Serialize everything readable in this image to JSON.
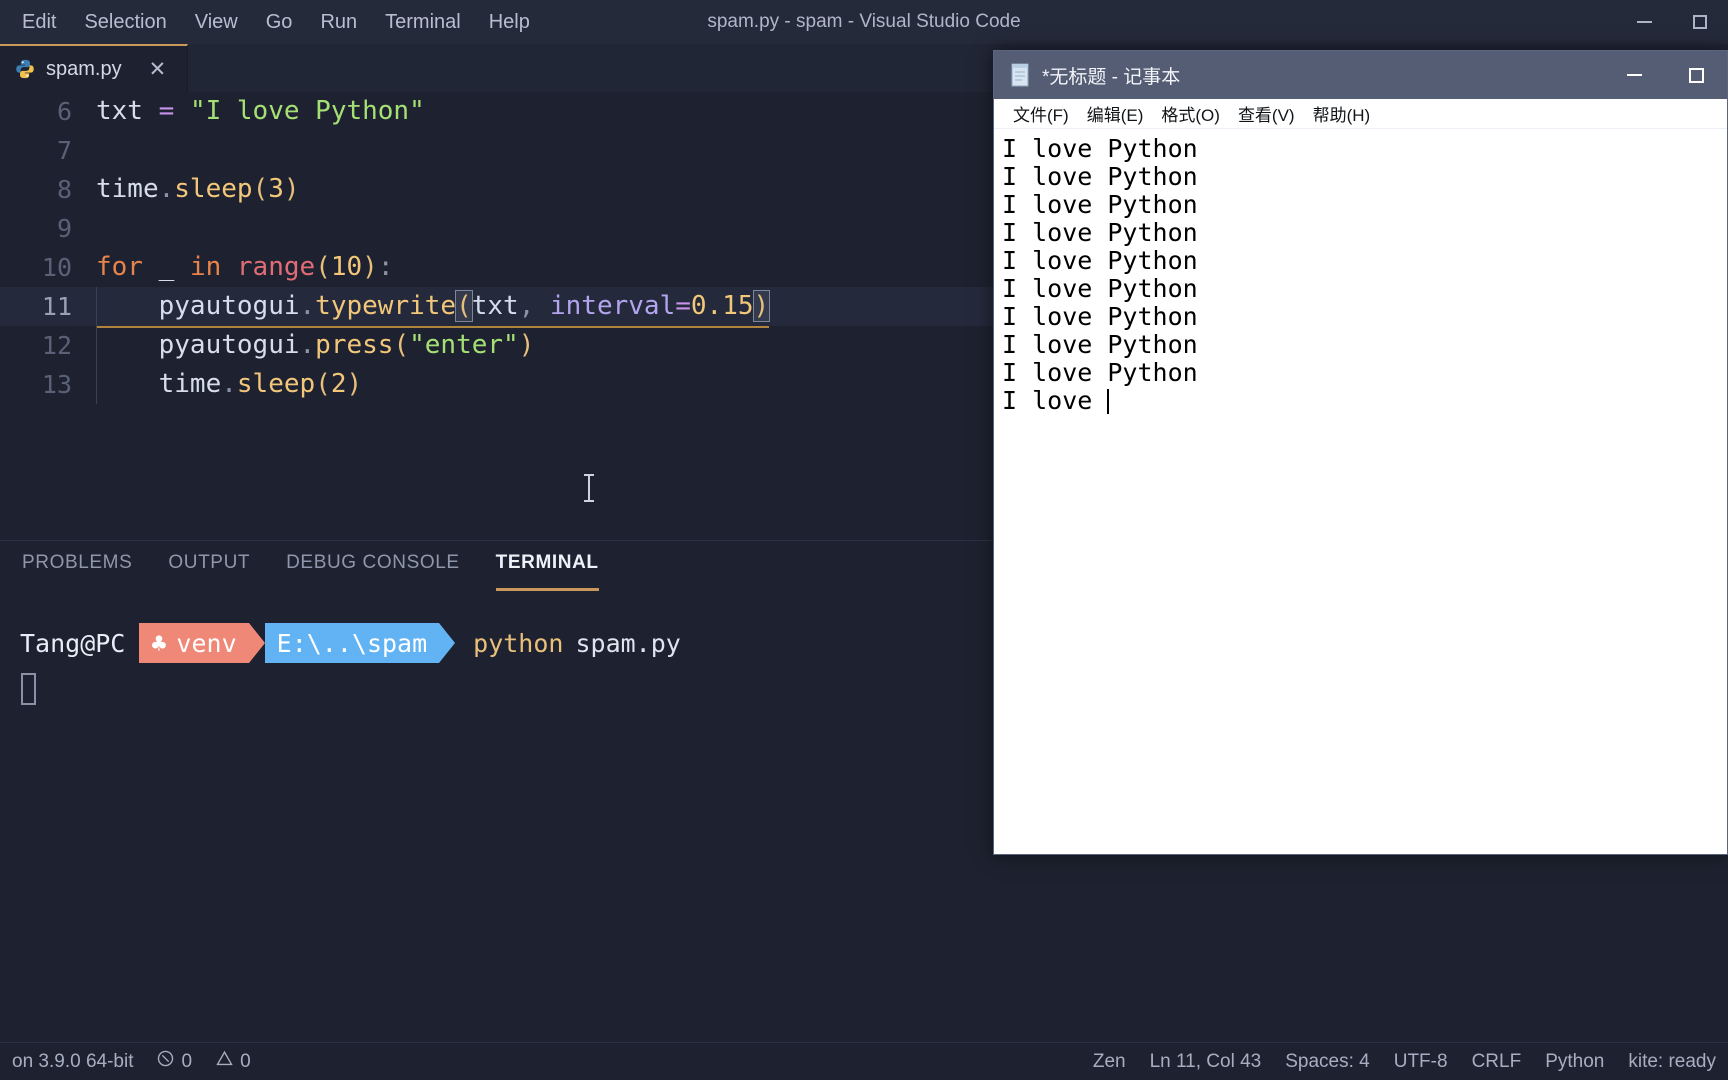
{
  "vscode": {
    "window_title": "spam.py - spam - Visual Studio Code",
    "menu": [
      {
        "label": "Edit"
      },
      {
        "label": "Selection"
      },
      {
        "label": "View"
      },
      {
        "label": "Go"
      },
      {
        "label": "Run"
      },
      {
        "label": "Terminal"
      },
      {
        "label": "Help"
      }
    ],
    "window_controls": {
      "minimize": "minimize-icon",
      "maximize": "maximize-icon"
    },
    "tab": {
      "label": "spam.py",
      "icon": "python-file-icon",
      "close": "✕",
      "accent_color": "#c9985a"
    },
    "editor": {
      "language": "Python",
      "lines": [
        {
          "number": "6",
          "active": false,
          "indent_guide": false,
          "tokens": [
            {
              "text": "txt",
              "cls": "t-var"
            },
            {
              "text": " ",
              "cls": "t-plain"
            },
            {
              "text": "=",
              "cls": "t-op"
            },
            {
              "text": " ",
              "cls": "t-plain"
            },
            {
              "text": "\"I love Python\"",
              "cls": "t-str"
            }
          ]
        },
        {
          "number": "7",
          "active": false,
          "indent_guide": false,
          "tokens": []
        },
        {
          "number": "8",
          "active": false,
          "indent_guide": false,
          "tokens": [
            {
              "text": "time",
              "cls": "t-var"
            },
            {
              "text": ".",
              "cls": "t-punct"
            },
            {
              "text": "sleep",
              "cls": "t-fn"
            },
            {
              "text": "(",
              "cls": "t-paren"
            },
            {
              "text": "3",
              "cls": "t-num"
            },
            {
              "text": ")",
              "cls": "t-paren"
            }
          ]
        },
        {
          "number": "9",
          "active": false,
          "indent_guide": false,
          "tokens": []
        },
        {
          "number": "10",
          "active": false,
          "indent_guide": false,
          "tokens": [
            {
              "text": "for",
              "cls": "t-kw"
            },
            {
              "text": " ",
              "cls": "t-plain"
            },
            {
              "text": "_",
              "cls": "t-var"
            },
            {
              "text": " ",
              "cls": "t-plain"
            },
            {
              "text": "in",
              "cls": "t-kw"
            },
            {
              "text": " ",
              "cls": "t-plain"
            },
            {
              "text": "range",
              "cls": "t-builtin"
            },
            {
              "text": "(",
              "cls": "t-paren"
            },
            {
              "text": "10",
              "cls": "t-num"
            },
            {
              "text": ")",
              "cls": "t-paren"
            },
            {
              "text": ":",
              "cls": "t-punct"
            }
          ]
        },
        {
          "number": "11",
          "active": true,
          "indent_guide": true,
          "tokens": [
            {
              "text": "    ",
              "cls": "t-plain"
            },
            {
              "text": "pyautogui",
              "cls": "t-var"
            },
            {
              "text": ".",
              "cls": "t-punct"
            },
            {
              "text": "typewrite",
              "cls": "t-fn"
            },
            {
              "text": "(",
              "cls": "t-paren bracket-match"
            },
            {
              "text": "txt",
              "cls": "t-var"
            },
            {
              "text": ",",
              "cls": "t-punct"
            },
            {
              "text": " ",
              "cls": "t-plain"
            },
            {
              "text": "interval",
              "cls": "t-param"
            },
            {
              "text": "=",
              "cls": "t-op"
            },
            {
              "text": "0.15",
              "cls": "t-num"
            },
            {
              "text": ")",
              "cls": "t-paren bracket-match"
            }
          ]
        },
        {
          "number": "12",
          "active": false,
          "indent_guide": true,
          "tokens": [
            {
              "text": "    ",
              "cls": "t-plain"
            },
            {
              "text": "pyautogui",
              "cls": "t-var"
            },
            {
              "text": ".",
              "cls": "t-punct"
            },
            {
              "text": "press",
              "cls": "t-fn"
            },
            {
              "text": "(",
              "cls": "t-paren"
            },
            {
              "text": "\"enter\"",
              "cls": "t-str"
            },
            {
              "text": ")",
              "cls": "t-paren"
            }
          ]
        },
        {
          "number": "13",
          "active": false,
          "indent_guide": true,
          "tokens": [
            {
              "text": "    ",
              "cls": "t-plain"
            },
            {
              "text": "time",
              "cls": "t-var"
            },
            {
              "text": ".",
              "cls": "t-punct"
            },
            {
              "text": "sleep",
              "cls": "t-fn"
            },
            {
              "text": "(",
              "cls": "t-paren"
            },
            {
              "text": "2",
              "cls": "t-num"
            },
            {
              "text": ")",
              "cls": "t-paren"
            }
          ]
        }
      ]
    },
    "panel": {
      "tabs": [
        {
          "label": "PROBLEMS",
          "selected": false
        },
        {
          "label": "OUTPUT",
          "selected": false
        },
        {
          "label": "DEBUG CONSOLE",
          "selected": false
        },
        {
          "label": "TERMINAL",
          "selected": true
        }
      ],
      "terminal": {
        "user_host": "Tang@PC",
        "venv_icon": "clover-icon",
        "venv_label": "venv",
        "path_label": "E:\\..\\spam",
        "command": "python",
        "command_arg": "spam.py",
        "venv_color": "#f08878",
        "path_color": "#62b3f3"
      }
    },
    "statusbar": {
      "left": [
        {
          "label": "on 3.9.0 64-bit",
          "icon": null
        },
        {
          "label": "0",
          "icon": "error-icon"
        },
        {
          "label": "0",
          "icon": "warning-icon"
        }
      ],
      "right": [
        {
          "label": "Zen"
        },
        {
          "label": "Ln 11, Col 43"
        },
        {
          "label": "Spaces: 4"
        },
        {
          "label": "UTF-8"
        },
        {
          "label": "CRLF"
        },
        {
          "label": "Python"
        },
        {
          "label": "kite: ready"
        }
      ]
    }
  },
  "notepad": {
    "title": "*无标题 - 记事本",
    "icon": "notepad-icon",
    "window_controls": {
      "minimize": "minimize-icon",
      "maximize": "maximize-icon"
    },
    "menu": [
      {
        "label": "文件(F)"
      },
      {
        "label": "编辑(E)"
      },
      {
        "label": "格式(O)"
      },
      {
        "label": "查看(V)"
      },
      {
        "label": "帮助(H)"
      }
    ],
    "content_lines": [
      "I love Python",
      "I love Python",
      "I love Python",
      "I love Python",
      "I love Python",
      "I love Python",
      "I love Python",
      "I love Python",
      "I love Python"
    ],
    "current_line": "I love ",
    "has_cursor": true
  }
}
